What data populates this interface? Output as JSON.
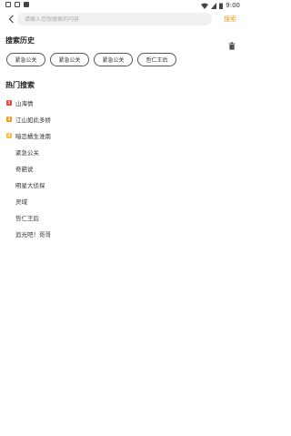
{
  "status_bar": {
    "time": "9:00"
  },
  "search": {
    "placeholder": "请输入您想搜索的内容",
    "action_label": "搜索"
  },
  "history": {
    "title": "搜索历史",
    "items": [
      {
        "label": "紧急公关"
      },
      {
        "label": "紧急公关"
      },
      {
        "label": "紧急公关"
      },
      {
        "label": "哲仁王后"
      }
    ]
  },
  "hot": {
    "title": "热门搜索",
    "items": [
      {
        "rank": "1",
        "label": "山海情",
        "badge_color": "#e8453c"
      },
      {
        "rank": "2",
        "label": "江山如此多娇",
        "badge_color": "#f39b1c"
      },
      {
        "rank": "3",
        "label": "暗恋橘生淮南",
        "badge_color": "#f5c23d"
      },
      {
        "label": "紧急公关"
      },
      {
        "label": "奇葩说"
      },
      {
        "label": "明星大侦探"
      },
      {
        "label": "灵域"
      },
      {
        "label": "哲仁王后"
      },
      {
        "label": "追光吧！哥哥"
      }
    ]
  },
  "colors": {
    "accent": "#f39b1c"
  }
}
